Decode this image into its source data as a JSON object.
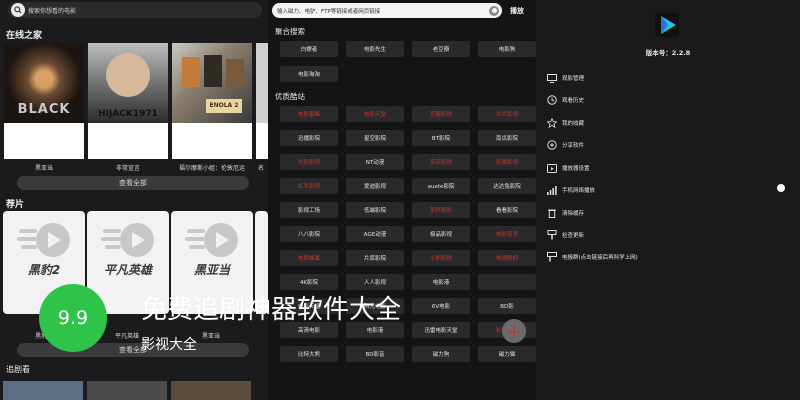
{
  "left": {
    "search_placeholder": "搜索你想看的电影",
    "online_title": "在线之家",
    "online_items": [
      {
        "title": "黑亚当"
      },
      {
        "title": "非常宣言"
      },
      {
        "title": "福尔摩斯小姐：伦敦厄运"
      },
      {
        "title": "名"
      }
    ],
    "view_all": "查看全部",
    "reco_title": "荐片",
    "reco_items": [
      {
        "title": "黑豹2",
        "caption": "黑豹2"
      },
      {
        "title": "平凡英雄",
        "caption": "平凡英雄"
      },
      {
        "title": "黑亚当",
        "caption": "黑亚当"
      }
    ],
    "view_all_2": "查看全部",
    "watching_title": "追剧看"
  },
  "middle": {
    "url_placeholder": "输入磁力、电驴、FTP等链接或者网页链接",
    "play_label": "播放",
    "aggregate_title": "聚合搜索",
    "aggregate_sites": [
      "白嫖者",
      "电影先生",
      "老豆瓣",
      "电影狗",
      "电影淘淘"
    ],
    "quality_title": "优质酷站",
    "quality_sites": [
      {
        "name": "电影蜜蜂",
        "red": true
      },
      {
        "name": "电影天堂",
        "red": true
      },
      {
        "name": "豆瓣影视",
        "red": true
      },
      {
        "name": "片片影视",
        "red": true
      },
      {
        "name": "迅播影院",
        "red": false
      },
      {
        "name": "星空影院",
        "red": false
      },
      {
        "name": "BT影院",
        "red": false
      },
      {
        "name": "南瓜影院",
        "red": false
      },
      {
        "name": "光影影视",
        "red": true
      },
      {
        "name": "NT动漫",
        "red": false
      },
      {
        "name": "奈菲影视",
        "red": true
      },
      {
        "name": "影猫影视",
        "red": true
      },
      {
        "name": "红牛影视",
        "red": true
      },
      {
        "name": "爱迪影视",
        "red": false
      },
      {
        "name": "auete影院",
        "red": false
      },
      {
        "name": "达达兔影院",
        "red": false
      },
      {
        "name": "影视工场",
        "red": false
      },
      {
        "name": "低端影院",
        "red": false
      },
      {
        "name": "茶杯狐影",
        "red": true
      },
      {
        "name": "看看影院",
        "red": false
      },
      {
        "name": "八八影院",
        "red": false
      },
      {
        "name": "AGE动漫",
        "red": false
      },
      {
        "name": "极品影视",
        "red": false
      },
      {
        "name": "电影猎手",
        "red": true
      },
      {
        "name": "电影蜂巢",
        "red": true
      },
      {
        "name": "片库影院",
        "red": false
      },
      {
        "name": "小熊影视",
        "red": true
      },
      {
        "name": "电视剧网",
        "red": true
      },
      {
        "name": "4K影院",
        "red": false
      },
      {
        "name": "人人影视",
        "red": false
      },
      {
        "name": "电影港",
        "red": false
      },
      {
        "name": "",
        "red": false
      },
      {
        "name": "电影天堂",
        "red": false
      },
      {
        "name": "阳光电影",
        "red": false
      },
      {
        "name": "6V电影",
        "red": false
      },
      {
        "name": "BD影",
        "red": false
      },
      {
        "name": "高清电影",
        "red": false
      },
      {
        "name": "电影港",
        "red": false
      },
      {
        "name": "迅雷电影天堂",
        "red": false
      },
      {
        "name": "影视天堂",
        "red": true
      },
      {
        "name": "比特大熊",
        "red": false
      },
      {
        "name": "BD影音",
        "red": false
      },
      {
        "name": "磁力狗",
        "red": false
      },
      {
        "name": "磁力猫",
        "red": false
      }
    ]
  },
  "right": {
    "version": "版本号：2.2.8",
    "menu": [
      {
        "label": "观影管理",
        "icon": "monitor-icon"
      },
      {
        "label": "观看历史",
        "icon": "history-icon"
      },
      {
        "label": "我的收藏",
        "icon": "star-icon"
      },
      {
        "label": "分享软件",
        "icon": "share-icon"
      },
      {
        "label": "播放器设置",
        "icon": "player-icon"
      },
      {
        "label": "手机网络播放",
        "icon": "signal-icon"
      },
      {
        "label": "清除缓存",
        "icon": "trash-icon"
      },
      {
        "label": "检查更新",
        "icon": "update-icon"
      },
      {
        "label": "电报群(点击链接后再科学上网)",
        "icon": "telegram-icon"
      }
    ]
  },
  "overlay": {
    "rating": "9.9",
    "headline": "免费追剧神器软件大全",
    "subline": "影视大全"
  },
  "colors": {
    "rating_green": "#2fc34a",
    "site_red": "#c0392b",
    "dark_bg": "#1b1b1d"
  }
}
